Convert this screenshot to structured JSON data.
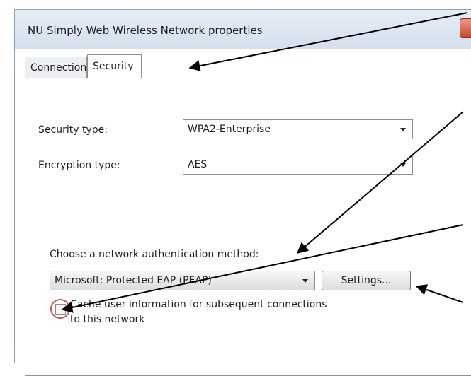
{
  "window": {
    "title": "NU Simply Web Wireless Network properties",
    "close_glyph": "✕"
  },
  "tabs": [
    {
      "label": "Connection",
      "selected": false
    },
    {
      "label": "Security",
      "selected": true
    }
  ],
  "security": {
    "security_type_label": "Security type:",
    "security_type_value": "WPA2-Enterprise",
    "encryption_type_label": "Encryption type:",
    "encryption_type_value": "AES",
    "auth_method_label": "Choose a network authentication method:",
    "auth_method_value": "Microsoft: Protected EAP (PEAP)",
    "settings_button": "Settings...",
    "cache_line1": "Cache user information for subsequent connections",
    "cache_line2": "to this network",
    "cache_checked": false
  },
  "colors": {
    "annotation_arrow": "#000000",
    "highlight_circle": "#c75a5a"
  }
}
